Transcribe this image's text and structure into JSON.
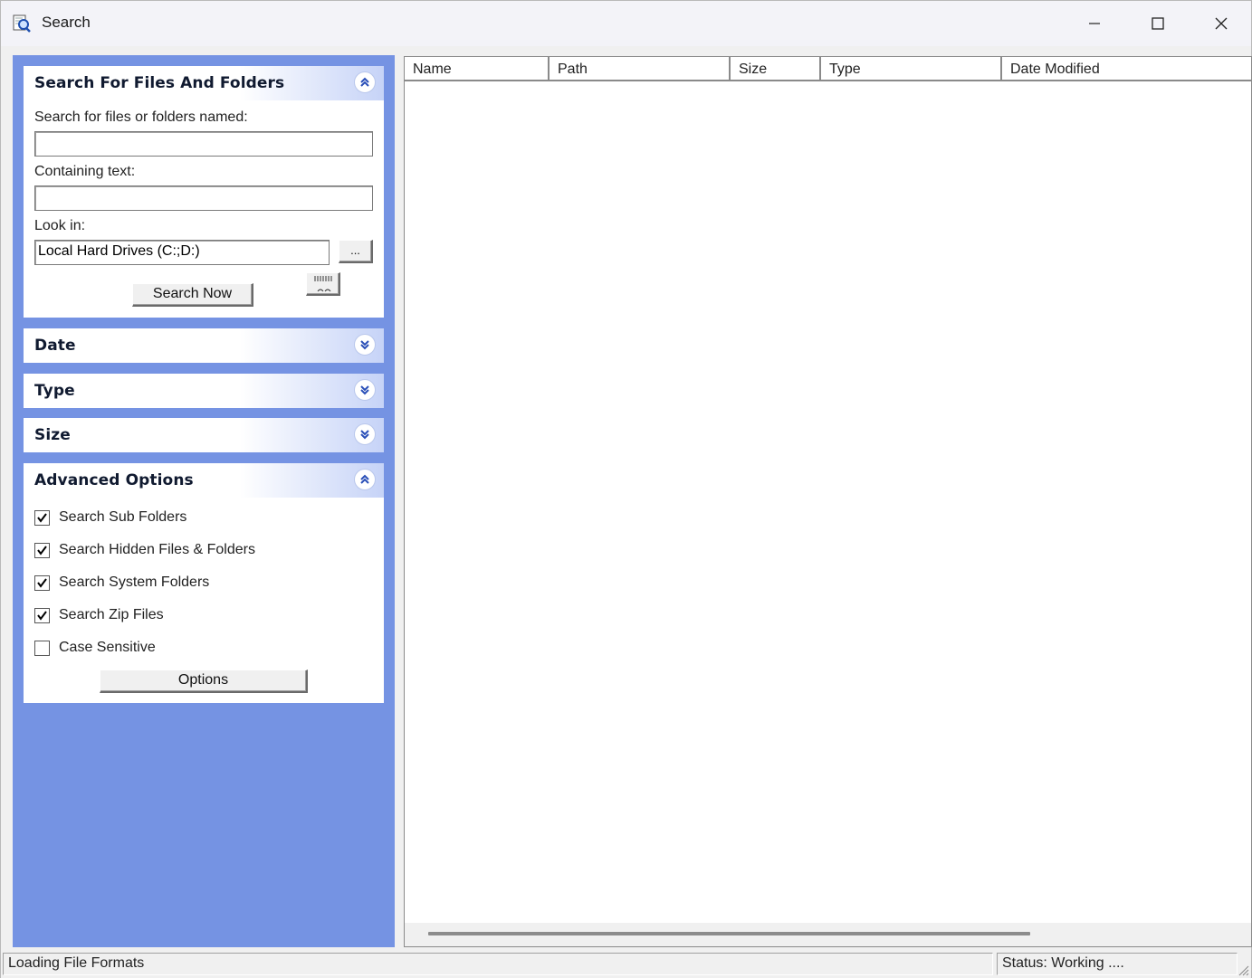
{
  "window": {
    "title": "Search",
    "icon": "search-magnifier-icon"
  },
  "search_group": {
    "title": "Search For Files And Folders",
    "name_label": "Search for files or folders named:",
    "name_value": "",
    "text_label": "Containing text:",
    "text_value": "",
    "lookin_label": "Look in:",
    "lookin_value": "Local Hard Drives (C:;D:)",
    "browse_label": "...",
    "search_now_label": "Search Now"
  },
  "date_group": {
    "title": "Date"
  },
  "type_group": {
    "title": "Type"
  },
  "size_group": {
    "title": "Size"
  },
  "advanced_group": {
    "title": "Advanced Options",
    "options": [
      {
        "label": "Search Sub Folders",
        "checked": true
      },
      {
        "label": "Search Hidden Files & Folders",
        "checked": true
      },
      {
        "label": "Search System Folders",
        "checked": true
      },
      {
        "label": "Search Zip Files",
        "checked": true
      },
      {
        "label": "Case Sensitive",
        "checked": false
      }
    ],
    "options_button_label": "Options"
  },
  "results": {
    "columns": [
      "Name",
      "Path",
      "Size",
      "Type",
      "Date Modified"
    ],
    "rows": []
  },
  "statusbar": {
    "left_text": "Loading File Formats",
    "right_text": "Status: Working ...."
  },
  "colors": {
    "panel_bg": "#7593e3",
    "chevron": "#2a4fb8"
  }
}
